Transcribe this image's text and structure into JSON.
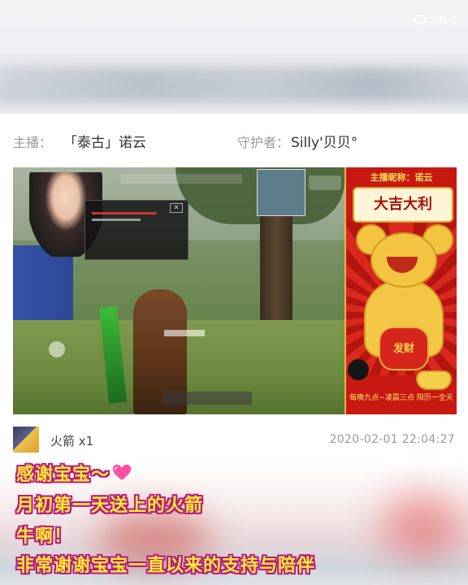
{
  "watermark": {
    "text": "大鱼号",
    "icon": "app-logo-icon"
  },
  "info": {
    "host_label": "主播：",
    "host_name": "「泰古」诺云",
    "guard_label": "守护者：",
    "guard_name": "Silly'贝贝°"
  },
  "poster": {
    "top_text": "主播昵称：诺云",
    "banner": "大吉大利",
    "pot_text": "发财",
    "bottom_text": "每晚九点~凌晨三点 阳历一全天"
  },
  "gift": {
    "name": "火箭 x1",
    "time": "2020-02-01 22:04:27"
  },
  "caption": {
    "line1": "感谢宝宝～",
    "line2": "月初第一天送上的火箭",
    "line3": "牛啊！",
    "line4": "非常谢谢宝宝一直以来的支持与陪伴"
  },
  "colors": {
    "caption_fill": "#ffeb2a",
    "caption_stroke": "#b51c8c",
    "heart": "#ff4fa3"
  }
}
